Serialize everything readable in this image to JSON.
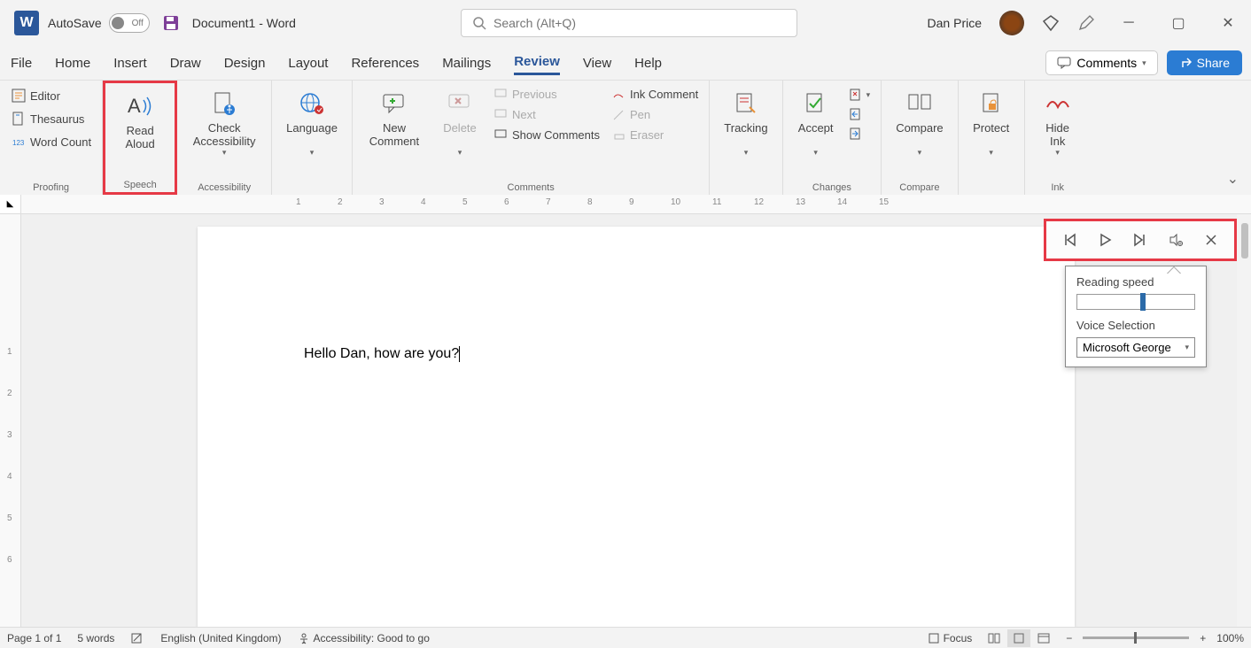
{
  "title_bar": {
    "autosave_label": "AutoSave",
    "autosave_state": "Off",
    "document_title": "Document1  -  Word",
    "search_placeholder": "Search (Alt+Q)",
    "user_name": "Dan Price"
  },
  "tabs": {
    "items": [
      "File",
      "Home",
      "Insert",
      "Draw",
      "Design",
      "Layout",
      "References",
      "Mailings",
      "Review",
      "View",
      "Help"
    ],
    "active": "Review",
    "comments_button": "Comments",
    "share_button": "Share"
  },
  "ribbon": {
    "proofing": {
      "label": "Proofing",
      "editor": "Editor",
      "thesaurus": "Thesaurus",
      "word_count": "Word Count"
    },
    "speech": {
      "label": "Speech",
      "read_aloud": "Read Aloud"
    },
    "accessibility": {
      "label": "Accessibility",
      "check": "Check Accessibility"
    },
    "language": {
      "label": "Language"
    },
    "comments": {
      "label": "Comments",
      "new": "New Comment",
      "delete": "Delete",
      "previous": "Previous",
      "next": "Next",
      "show": "Show Comments",
      "ink_comment": "Ink Comment",
      "pen": "Pen",
      "eraser": "Eraser"
    },
    "tracking": {
      "label": "Tracking"
    },
    "changes": {
      "label": "Changes",
      "accept": "Accept"
    },
    "compare": {
      "label": "Compare",
      "compare_btn": "Compare"
    },
    "protect": {
      "label": "Protect"
    },
    "ink": {
      "label": "Ink",
      "hide": "Hide Ink"
    }
  },
  "document": {
    "body_text": "Hello Dan, how are you?"
  },
  "read_aloud": {
    "reading_speed_label": "Reading speed",
    "voice_selection_label": "Voice Selection",
    "voice_selected": "Microsoft George"
  },
  "status_bar": {
    "page": "Page 1 of 1",
    "words": "5 words",
    "language": "English (United Kingdom)",
    "accessibility": "Accessibility: Good to go",
    "focus": "Focus",
    "zoom": "100%"
  },
  "ruler": {
    "h_ticks": [
      "1",
      "2",
      "3",
      "4",
      "5",
      "6",
      "7",
      "8",
      "9",
      "10",
      "11",
      "12",
      "13",
      "14",
      "15"
    ],
    "v_ticks": [
      "1",
      "2",
      "3",
      "4",
      "5",
      "6"
    ]
  }
}
